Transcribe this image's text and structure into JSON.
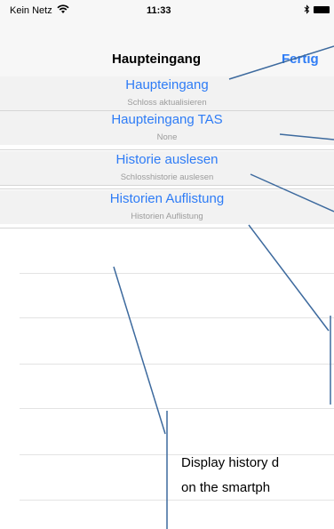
{
  "status_bar": {
    "carrier": "Kein Netz",
    "time": "11:33",
    "wifi_icon": "wifi-icon",
    "bluetooth_icon": "bluetooth-icon",
    "battery_icon": "battery-icon"
  },
  "nav": {
    "title": "Haupteingang",
    "done_label": "Fertig"
  },
  "items": [
    {
      "title": "Haupteingang",
      "subtitle": "Schloss aktualisieren"
    },
    {
      "title": "Haupteingang TAS",
      "subtitle": "None"
    },
    {
      "title": "Historie auslesen",
      "subtitle": "Schlosshistorie auslesen"
    },
    {
      "title": "Historien Auflistung",
      "subtitle": "Historien Auflistung"
    }
  ],
  "annotation": {
    "line1": "Display history d",
    "line2": "on the smartph"
  },
  "colors": {
    "accent": "#2e7cf6",
    "annotation_line": "#3d6a9e"
  }
}
